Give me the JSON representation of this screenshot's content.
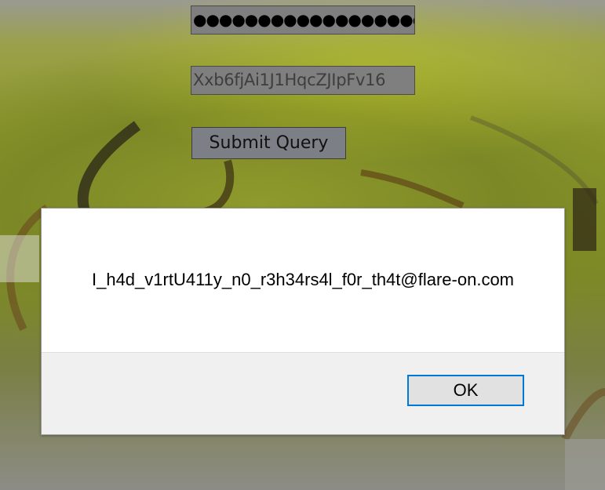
{
  "form": {
    "password_value": "●●●●●●●●●●●●●●●●●●",
    "text_value": "Xxb6fjAi1J1HqcZJIpFv16",
    "submit_label": "Submit Query"
  },
  "alert": {
    "message": "I_h4d_v1rtU411y_n0_r3h34rs4l_f0r_th4t@flare-on.com",
    "ok_label": "OK"
  },
  "colors": {
    "ok_focus_border": "#0078d7",
    "dialog_footer": "#f0f0f0"
  }
}
